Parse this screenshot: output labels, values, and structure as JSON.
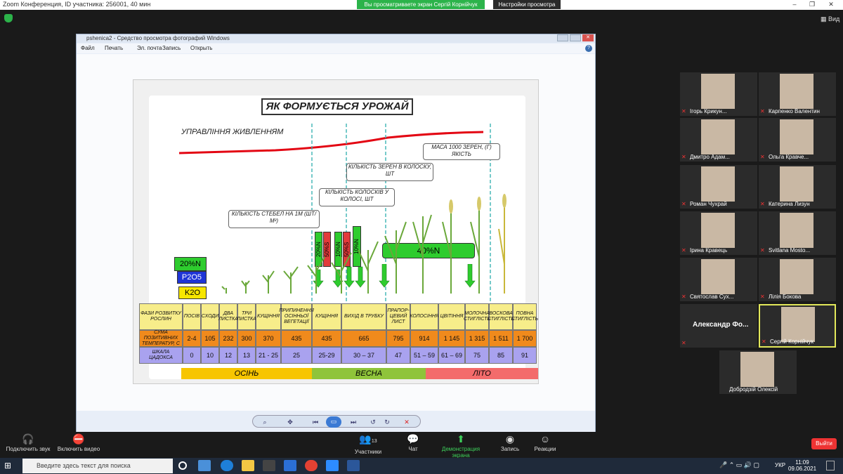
{
  "zoom": {
    "title": "Zoom Конференция, ID участника: 256001, 40 мин",
    "banner": "Вы просматриваете экран Сергій Корнійчук",
    "view_options": "Настройки просмотра",
    "view_label": "Вид"
  },
  "viewer": {
    "title": "pshenica2 - Средство просмотра фотографий Windows",
    "menu": [
      "Файл",
      "Печать",
      "Эл. почта",
      "Запись",
      "Открыть"
    ]
  },
  "slide": {
    "title": "ЯК ФОРМУЄТЬСЯ УРОЖАЙ",
    "nutrition": "УПРАВЛІННЯ ЖИВЛЕННЯМ",
    "b1": "КІЛЬКІСТЬ СТЕБЕЛ НА 1М (ШТ/М²)",
    "b2": "КІЛЬКІСТЬ КОЛОСКІВ У КОЛОСІ, ШТ",
    "b3": "КІЛЬКІСТЬ ЗЕРЕН В КОЛОСКУ, ШТ",
    "b4": "МАСА 1000 ЗЕРЕН, (Г) ЯКІСТЬ",
    "n20": "20%N",
    "p2o5": "P2O5",
    "k2o": "K2O",
    "v20n": "20%N",
    "v50s": "50%S",
    "v10n": "10%N",
    "v50s2": "50%S",
    "v10n2": "10%N",
    "n40": "40%N",
    "row1_label": "ФАЗИ РОЗВИТКУ РОСЛИН",
    "phases": [
      "ПОСІВ",
      "СХОДИ",
      "ДВА ЛИСТКА",
      "ТРИ ЛИСТКА",
      "КУЩІННЯ",
      "ПРИПИНЕННЯ ОСІННЬОЇ ВЕГЕТАЦІЇ",
      "КУЩІННЯ",
      "ВИХІД В ТРУБКУ",
      "ПРАПОР-ЦЕВИЙ ЛИСТ",
      "КОЛОСІННЯ",
      "ЦВІТІННЯ",
      "МОЛОЧНА СТИГЛІСТЬ",
      "ВОСКОВА СТИГЛІСТЬ",
      "ПОВНА СТИГЛІСТЬ"
    ],
    "row2_label": "СУМА ПОЗИТИВНИХ ТЕМПЕРАТУР, С",
    "temps": [
      "2-4",
      "105",
      "232",
      "300",
      "370",
      "435",
      "435",
      "665",
      "795",
      "914",
      "1 145",
      "1 315",
      "1 511",
      "1 700"
    ],
    "row3_label": "ШКАЛА ЦАДОКСА",
    "zadoks": [
      "0",
      "10",
      "12",
      "13",
      "21 - 25",
      "25",
      "25-29",
      "30 – 37",
      "47",
      "51 – 59",
      "61 – 69",
      "75",
      "85",
      "91"
    ],
    "seasons": [
      "ОСІНЬ",
      "ВЕСНА",
      "ЛІТО"
    ]
  },
  "participants": [
    {
      "name": "Ігорь Крикун..."
    },
    {
      "name": "Карпенко Валентин"
    },
    {
      "name": "Дмитро Адам..."
    },
    {
      "name": "Ольга Кравче..."
    },
    {
      "name": "Роман Чухрай"
    },
    {
      "name": "Катерина Лизун"
    },
    {
      "name": "Ірина Кравець"
    },
    {
      "name": "Svitlana Mosto..."
    },
    {
      "name": "Святослав Сух..."
    },
    {
      "name": "Лілія Бокова"
    },
    {
      "name": "Александр Фо..."
    },
    {
      "name": "Сергій Корнійчук"
    },
    {
      "name": "Добродзій Олексій"
    }
  ],
  "toolbar": {
    "audio": "Подключить звук",
    "video": "Включить видео",
    "participants": "Участники",
    "participants_count": "13",
    "chat": "Чат",
    "share": "Демонстрация экрана",
    "record": "Запись",
    "reactions": "Реакции",
    "leave": "Выйти"
  },
  "taskbar": {
    "search": "Введите здесь текст для поиска",
    "lang": "УКР",
    "time": "11:09",
    "date": "09.06.2021"
  }
}
